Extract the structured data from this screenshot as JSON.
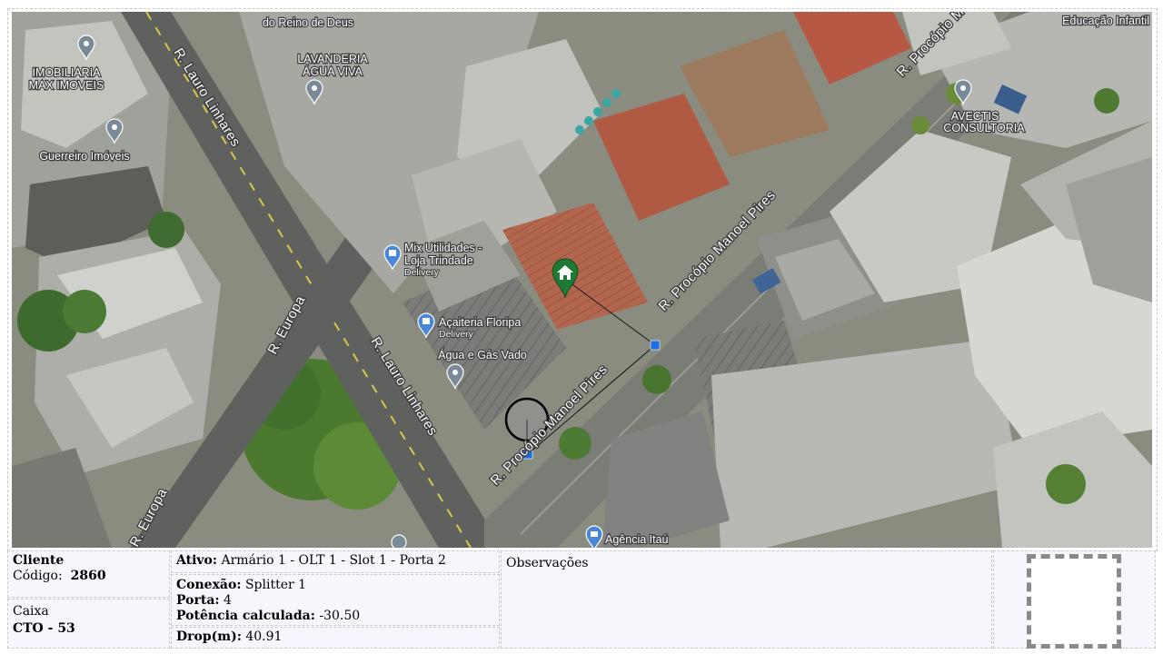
{
  "map": {
    "street_labels": [
      "R. Lauro Linhares",
      "R. Procópio Manoel Pires",
      "R. Procópio Manoel Pires",
      "R. Europa",
      "R. Lauro Linhares",
      "R. Europa",
      "R. Procópio M"
    ],
    "pins": [
      {
        "name": "IMOBILIARIA MAX IMOVEIS",
        "lines": [
          "IMOBILIARIA",
          "MAX IMOVEIS"
        ],
        "icon": "map-pin-icon"
      },
      {
        "name": "Guerreiro Imóveis",
        "lines": [
          "Guerreiro Imóveis"
        ],
        "icon": "map-pin-icon"
      },
      {
        "name": "LAVANDERIA ÁGUA VIVA",
        "lines": [
          "LAVANDERIA",
          "ÁGUA VIVA"
        ],
        "icon": "map-pin-icon"
      },
      {
        "name": "Mix Utilidades - Loja Trindade",
        "lines": [
          "Mix Utilidades -",
          "Loja Trindade"
        ],
        "sub": "Delivery",
        "icon": "shopping-bag-icon"
      },
      {
        "name": "Açaiteria Floripa",
        "lines": [
          "Açaiteria Floripa"
        ],
        "sub": "Delivery",
        "icon": "shopping-bag-icon"
      },
      {
        "name": "Água e Gás Vado",
        "lines": [
          "Água e Gás Vado"
        ],
        "icon": "map-pin-icon"
      },
      {
        "name": "AVECTIS CONSULTORIA",
        "lines": [
          "AVECTIS",
          "CONSULTORIA"
        ],
        "icon": "map-pin-icon"
      },
      {
        "name": "Agência Itaú",
        "lines": [
          "Agência Itaú"
        ],
        "icon": "bank-icon"
      },
      {
        "name": "Educação Infantil",
        "lines": [
          "Educação Infantil"
        ],
        "icon": "school-icon"
      },
      {
        "name": "do Reino de Deus",
        "lines": [
          "do Reino de Deus"
        ],
        "icon": "map-pin-icon"
      }
    ],
    "markers": {
      "client": {
        "icon": "home-icon",
        "color": "#1e7a34"
      },
      "cto": {
        "icon": "circle-marker-icon"
      },
      "route_points": {
        "color": "#1f6fe0"
      }
    }
  },
  "client": {
    "title": "Cliente",
    "code_label": "Código:",
    "code_value": "2860"
  },
  "box": {
    "title": "Caixa",
    "value": "CTO - 53"
  },
  "asset": {
    "label": "Ativo:",
    "value": "Armário 1 - OLT 1 - Slot 1 - Porta 2"
  },
  "connection": {
    "conn_label": "Conexão:",
    "conn_value": "Splitter 1",
    "port_label": "Porta:",
    "port_value": "4",
    "power_label": "Potência calculada:",
    "power_value": "-30.50"
  },
  "drop": {
    "label": "Drop(m):",
    "value": "40.91"
  },
  "notes": {
    "title": "Observações"
  },
  "qr": {
    "icon": "qr-placeholder-icon"
  }
}
